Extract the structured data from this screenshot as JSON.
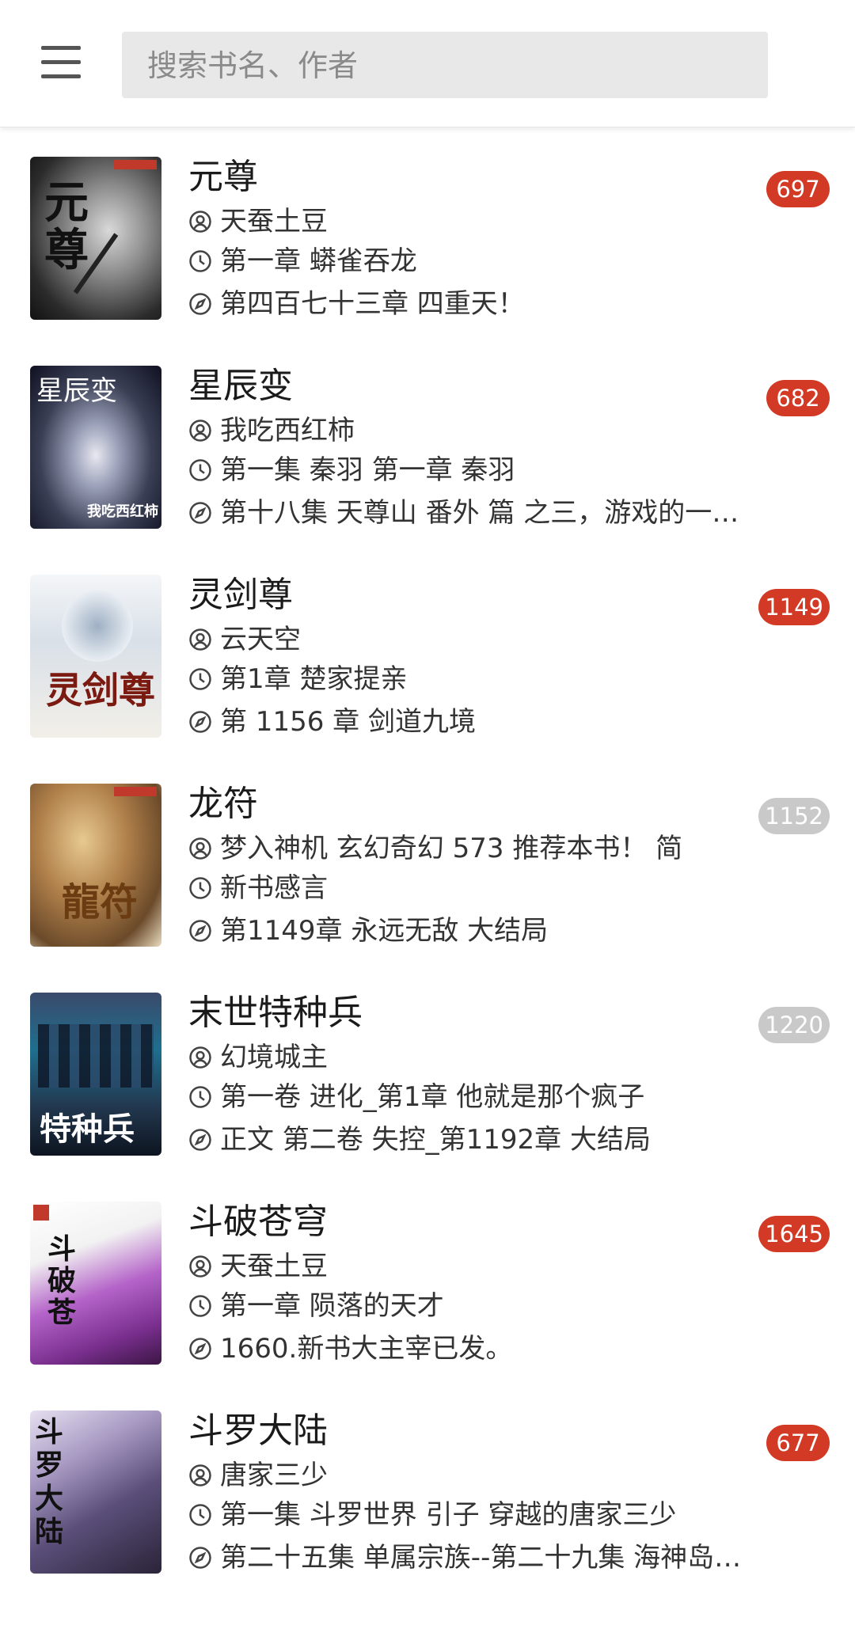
{
  "header": {
    "search_placeholder": "搜索书名、作者"
  },
  "colors": {
    "badge_unread": "#d23a26",
    "badge_read": "#c9c9c9"
  },
  "books": [
    {
      "title": "元尊",
      "author": "天蚕土豆",
      "first_chapter": "第一章 蟒雀吞龙",
      "latest_chapter": "第四百七十三章 四重天！",
      "count": "697",
      "badge_state": "unread"
    },
    {
      "title": "星辰变",
      "author": "我吃西红柿",
      "first_chapter": "第一集 秦羽 第一章 秦羽",
      "latest_chapter": "第十八集 天尊山 番外 篇 之三，游戏的一…",
      "count": "682",
      "badge_state": "unread"
    },
    {
      "title": "灵剑尊",
      "author": "云天空",
      "first_chapter": "第1章 楚家提亲",
      "latest_chapter": "第 1156 章 剑道九境",
      "count": "1149",
      "badge_state": "unread"
    },
    {
      "title": "龙符",
      "author": "梦入神机 玄幻奇幻 573 推荐本书！ 简",
      "first_chapter": "新书感言",
      "latest_chapter": "第1149章 永远无敌 大结局",
      "count": "1152",
      "badge_state": "read"
    },
    {
      "title": "末世特种兵",
      "author": "幻境城主",
      "first_chapter": "第一卷 进化_第1章 他就是那个疯子",
      "latest_chapter": "正文 第二卷 失控_第1192章 大结局",
      "count": "1220",
      "badge_state": "read"
    },
    {
      "title": "斗破苍穹",
      "author": "天蚕土豆",
      "first_chapter": "第一章 陨落的天才",
      "latest_chapter": "1660.新书大主宰已发。",
      "count": "1645",
      "badge_state": "unread"
    },
    {
      "title": "斗罗大陆",
      "author": "唐家三少",
      "first_chapter": "第一集 斗罗世界 引子 穿越的唐家三少",
      "latest_chapter": "第二十五集 单属宗族--第二十九集 海神岛…",
      "count": "677",
      "badge_state": "unread"
    }
  ]
}
